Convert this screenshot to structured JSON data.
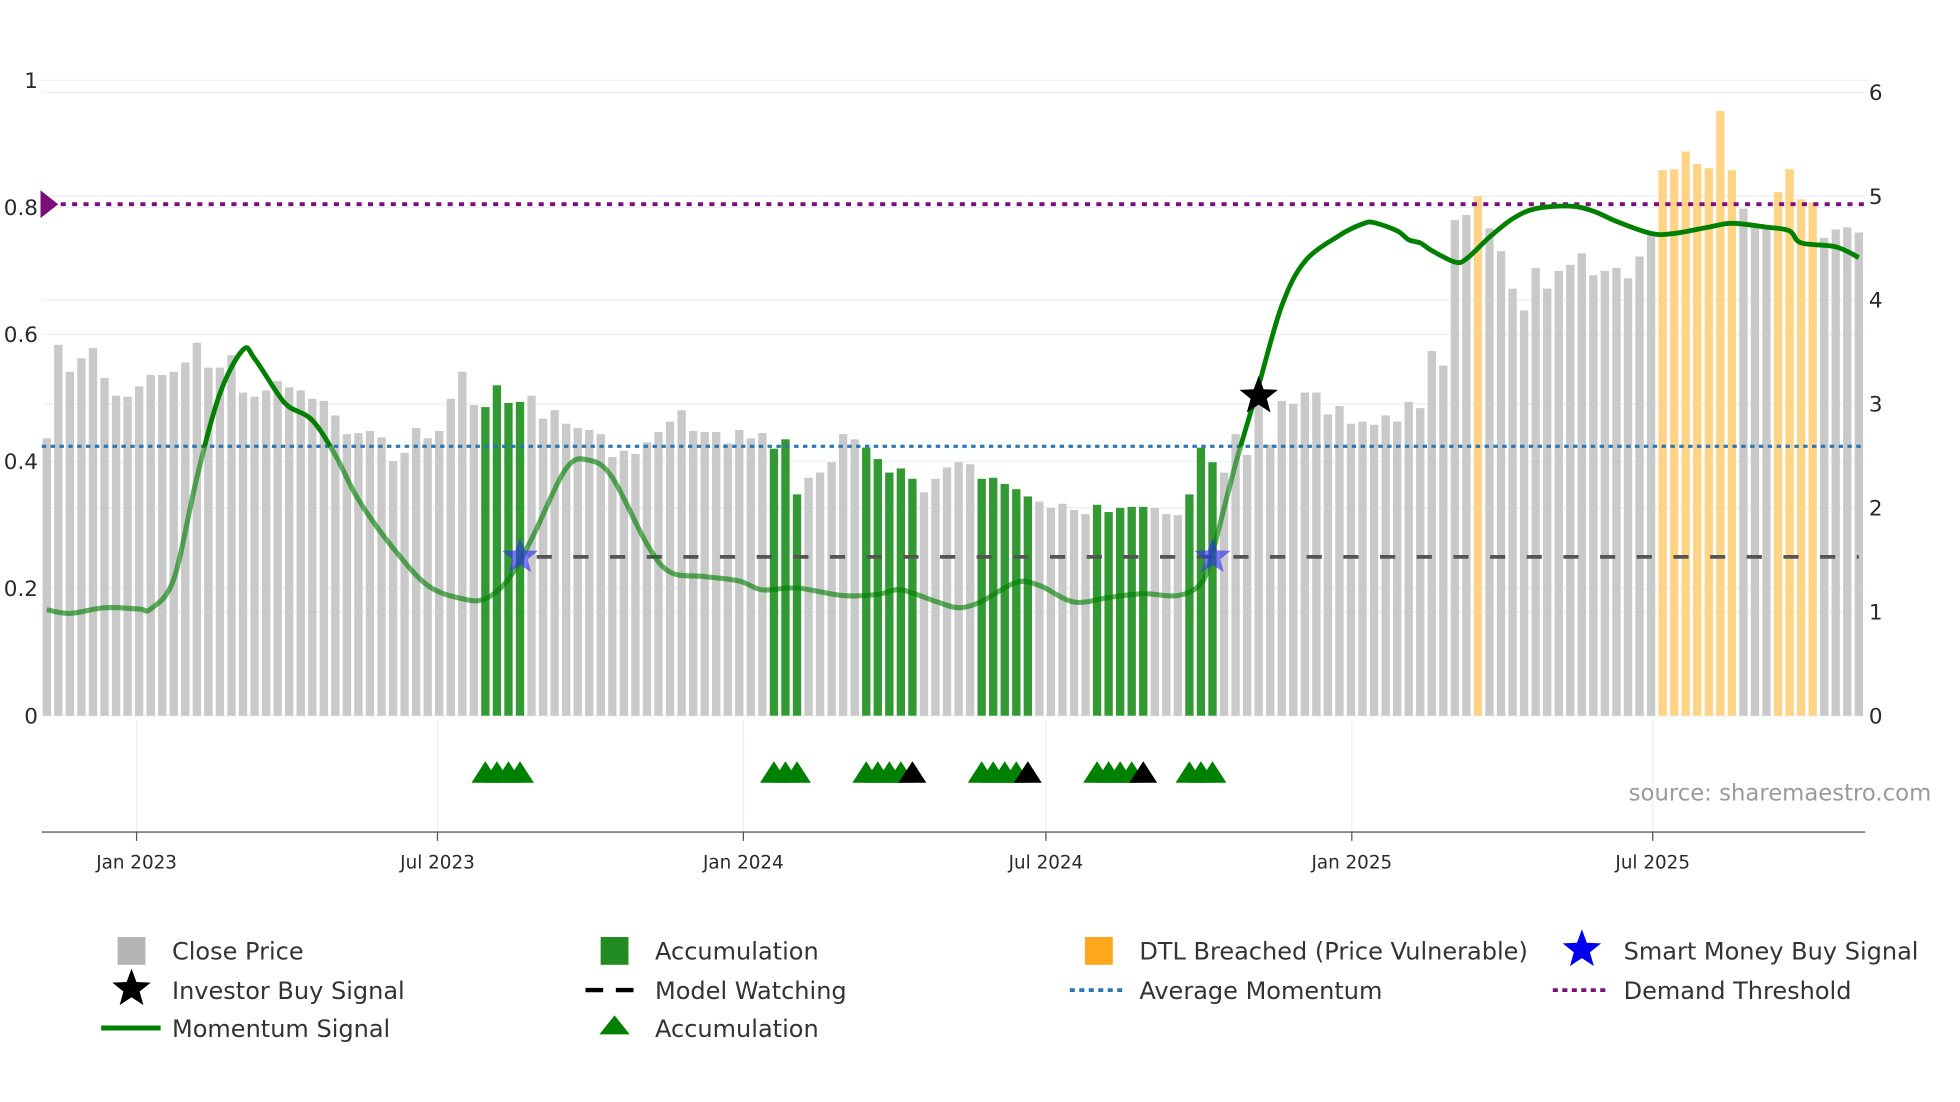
{
  "chart_data": {
    "type": "bar",
    "title": "",
    "start_date": "2022-11-08",
    "interval": "weekly",
    "left_axis": {
      "range": [
        0,
        1
      ],
      "ticks": [
        "0",
        "0.2",
        "0.4",
        "0.6",
        "0.8",
        "1"
      ],
      "tick_values": [
        0,
        0.2,
        0.4,
        0.6,
        0.8,
        1
      ]
    },
    "right_axis": {
      "range": [
        0,
        6
      ],
      "ticks": [
        "0",
        "1",
        "2",
        "3",
        "4",
        "5",
        "6"
      ],
      "tick_values": [
        0,
        1,
        2,
        3,
        4,
        5,
        6
      ]
    },
    "x_ticks": [
      {
        "label": "Jan 2023",
        "date": "2023-01-01"
      },
      {
        "label": "Jul 2023",
        "date": "2023-07-01"
      },
      {
        "label": "Jan 2024",
        "date": "2024-01-01"
      },
      {
        "label": "Jul 2024",
        "date": "2024-07-01"
      },
      {
        "label": "Jan 2025",
        "date": "2025-01-01"
      },
      {
        "label": "Jul 2025",
        "date": "2025-07-01"
      }
    ],
    "close_price": [
      2.67,
      3.57,
      3.31,
      3.44,
      3.54,
      3.25,
      3.08,
      3.07,
      3.17,
      3.28,
      3.28,
      3.31,
      3.4,
      3.59,
      3.35,
      3.35,
      3.47,
      3.11,
      3.07,
      3.13,
      3.22,
      3.16,
      3.13,
      3.05,
      3.03,
      2.89,
      2.71,
      2.72,
      2.74,
      2.68,
      2.45,
      2.53,
      2.77,
      2.67,
      2.74,
      3.05,
      3.31,
      2.99,
      2.97,
      3.18,
      3.01,
      3.02,
      3.08,
      2.86,
      2.94,
      2.81,
      2.77,
      2.75,
      2.71,
      2.49,
      2.55,
      2.52,
      2.63,
      2.73,
      2.83,
      2.94,
      2.74,
      2.73,
      2.73,
      2.62,
      2.75,
      2.67,
      2.72,
      2.57,
      2.66,
      2.13,
      2.29,
      2.34,
      2.44,
      2.71,
      2.66,
      2.58,
      2.47,
      2.34,
      2.38,
      2.28,
      2.15,
      2.28,
      2.39,
      2.44,
      2.42,
      2.28,
      2.29,
      2.23,
      2.18,
      2.11,
      2.06,
      2.0,
      2.04,
      1.98,
      1.94,
      2.03,
      1.96,
      2.0,
      2.01,
      2.01,
      2.0,
      1.94,
      1.93,
      2.13,
      2.58,
      2.44,
      2.34,
      2.71,
      2.51,
      3.01,
      2.61,
      3.03,
      3.0,
      3.11,
      3.11,
      2.9,
      2.98,
      2.81,
      2.83,
      2.8,
      2.89,
      2.83,
      3.02,
      2.96,
      3.51,
      3.37,
      4.77,
      4.82,
      5.0,
      4.69,
      4.47,
      4.11,
      3.9,
      4.31,
      4.11,
      4.28,
      4.34,
      4.45,
      4.24,
      4.28,
      4.31,
      4.21,
      4.42,
      4.66,
      5.25,
      5.26,
      5.43,
      5.31,
      5.27,
      5.82,
      5.25,
      4.88,
      4.71,
      4.69,
      5.04,
      5.26,
      4.97,
      4.94,
      4.6,
      4.68,
      4.7,
      4.65
    ],
    "accumulation_bars": [
      38,
      39,
      40,
      41,
      63,
      64,
      65,
      71,
      72,
      73,
      74,
      75,
      81,
      82,
      83,
      84,
      85,
      91,
      92,
      93,
      94,
      95,
      99,
      100,
      101
    ],
    "dtl_breached_bars": [
      124,
      140,
      141,
      142,
      143,
      144,
      145,
      146,
      150,
      151,
      152,
      153
    ],
    "momentum_signal": [
      [
        0,
        0.167
      ],
      [
        2,
        0.161
      ],
      [
        5,
        0.17
      ],
      [
        8,
        0.168
      ],
      [
        9,
        0.168
      ],
      [
        11,
        0.215
      ],
      [
        13,
        0.375
      ],
      [
        15,
        0.507
      ],
      [
        17,
        0.576
      ],
      [
        18,
        0.562
      ],
      [
        20,
        0.507
      ],
      [
        21,
        0.486
      ],
      [
        23,
        0.465
      ],
      [
        25,
        0.41
      ],
      [
        27,
        0.34
      ],
      [
        30,
        0.264
      ],
      [
        33,
        0.205
      ],
      [
        36,
        0.184
      ],
      [
        38,
        0.184
      ],
      [
        40,
        0.215
      ],
      [
        42,
        0.278
      ],
      [
        45,
        0.389
      ],
      [
        47,
        0.402
      ],
      [
        49,
        0.375
      ],
      [
        52,
        0.27
      ],
      [
        54,
        0.226
      ],
      [
        57,
        0.219
      ],
      [
        60,
        0.212
      ],
      [
        62,
        0.198
      ],
      [
        65,
        0.201
      ],
      [
        69,
        0.189
      ],
      [
        72,
        0.191
      ],
      [
        74,
        0.198
      ],
      [
        77,
        0.18
      ],
      [
        79,
        0.17
      ],
      [
        81,
        0.18
      ],
      [
        84,
        0.21
      ],
      [
        86,
        0.205
      ],
      [
        89,
        0.179
      ],
      [
        92,
        0.186
      ],
      [
        95,
        0.192
      ],
      [
        98,
        0.189
      ],
      [
        100,
        0.208
      ],
      [
        101,
        0.257
      ],
      [
        103,
        0.396
      ],
      [
        105,
        0.52
      ],
      [
        107,
        0.645
      ],
      [
        109,
        0.715
      ],
      [
        112,
        0.756
      ],
      [
        114,
        0.774
      ],
      [
        115,
        0.776
      ],
      [
        117,
        0.763
      ],
      [
        118,
        0.749
      ],
      [
        119,
        0.744
      ],
      [
        120,
        0.732
      ],
      [
        122,
        0.714
      ],
      [
        123,
        0.719
      ],
      [
        125,
        0.753
      ],
      [
        127,
        0.782
      ],
      [
        129,
        0.798
      ],
      [
        132,
        0.802
      ],
      [
        134,
        0.794
      ],
      [
        136,
        0.778
      ],
      [
        139,
        0.759
      ],
      [
        141,
        0.759
      ],
      [
        144,
        0.769
      ],
      [
        146,
        0.775
      ],
      [
        149,
        0.769
      ],
      [
        151,
        0.763
      ],
      [
        152,
        0.744
      ],
      [
        155,
        0.738
      ],
      [
        157,
        0.721
      ]
    ],
    "average_momentum": 0.424,
    "demand_threshold": 0.805,
    "model_watching": {
      "from_bar": 42,
      "level": 0.25
    },
    "smart_money_buy_signals": [
      {
        "bar": 41,
        "value": 0.25
      },
      {
        "bar": 101,
        "value": 0.25
      }
    ],
    "investor_buy_signals": [
      {
        "bar": 105,
        "value": 0.503
      }
    ],
    "accumulation_markers_green": [
      38,
      39,
      40,
      41,
      63,
      64,
      65,
      71,
      72,
      73,
      74,
      81,
      82,
      83,
      84,
      91,
      92,
      93,
      94,
      99,
      100,
      101
    ],
    "accumulation_markers_black": [
      75,
      85,
      95
    ],
    "legend": [
      {
        "label": "Close Price",
        "symbol": "square",
        "color": "#b5b5b5"
      },
      {
        "label": "Accumulation",
        "symbol": "square",
        "color": "#228b22"
      },
      {
        "label": "DTL Breached (Price Vulnerable)",
        "symbol": "square",
        "color": "#ffa81c"
      },
      {
        "label": "Smart Money Buy Signal",
        "symbol": "star",
        "color": "#0000ee"
      },
      {
        "label": "Investor Buy Signal",
        "symbol": "star",
        "color": "#000000"
      },
      {
        "label": "Model Watching",
        "symbol": "dash",
        "color": "#000000"
      },
      {
        "label": "Average Momentum",
        "symbol": "dot",
        "color": "#2a77b4"
      },
      {
        "label": "Demand Threshold",
        "symbol": "dot",
        "color": "#7a0f7a"
      },
      {
        "label": "Momentum Signal",
        "symbol": "line",
        "color": "#008000"
      },
      {
        "label": "Accumulation",
        "symbol": "triangle",
        "color": "#008000"
      }
    ],
    "colors": {
      "price": "#c9c9c9",
      "accumulation": "#339a33",
      "dtl": "#ffd486",
      "momentum": "#008000",
      "avg": "#2a77b4",
      "threshold": "#7a0f7a",
      "watching": "#555555"
    },
    "source": "source: sharemaestro.com"
  }
}
